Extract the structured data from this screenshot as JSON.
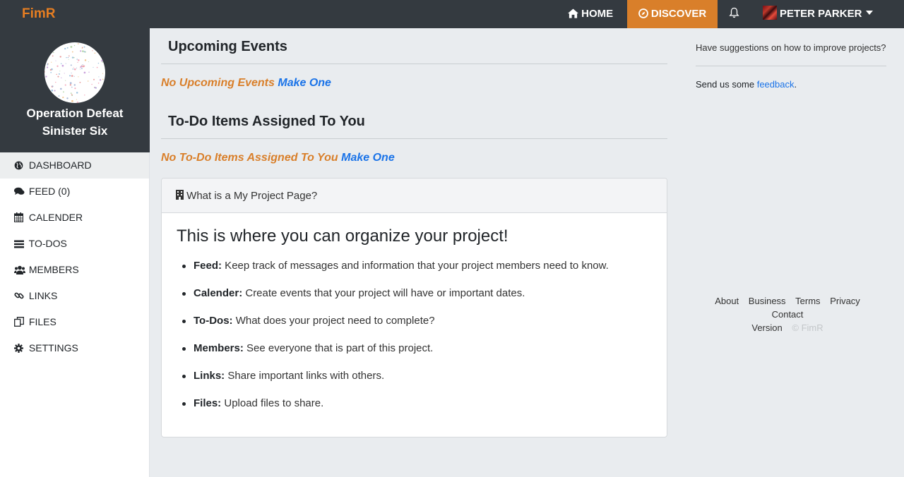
{
  "navbar": {
    "brand": "FimR",
    "home_label": "HOME",
    "discover_label": "DISCOVER",
    "user_name": "PETER PARKER"
  },
  "project": {
    "name_line1": "Operation Defeat",
    "name_line2": "Sinister Six"
  },
  "sidebar": {
    "items": [
      {
        "label": "DASHBOARD",
        "icon": "globe-icon",
        "active": true
      },
      {
        "label": "FEED (0)",
        "icon": "comments-icon"
      },
      {
        "label": "CALENDER",
        "icon": "calendar-icon"
      },
      {
        "label": "TO-DOS",
        "icon": "list-icon"
      },
      {
        "label": "MEMBERS",
        "icon": "users-icon"
      },
      {
        "label": "LINKS",
        "icon": "link-icon"
      },
      {
        "label": "FILES",
        "icon": "files-icon"
      },
      {
        "label": "SETTINGS",
        "icon": "gear-icon"
      }
    ]
  },
  "main": {
    "events_title": "Upcoming Events",
    "events_empty": "No Upcoming Events",
    "events_make": "Make One",
    "todos_title": "To-Do Items Assigned To You",
    "todos_empty": "No To-Do Items Assigned To You",
    "todos_make": "Make One",
    "card": {
      "header": "What is a My Project Page?",
      "title": "This is where you can organize your project!",
      "features": [
        {
          "name": "Feed:",
          "desc": " Keep track of messages and information that your project members need to know."
        },
        {
          "name": "Calender:",
          "desc": " Create events that your project will have or important dates."
        },
        {
          "name": "To-Dos:",
          "desc": " What does your project need to complete?"
        },
        {
          "name": "Members:",
          "desc": " See everyone that is part of this project."
        },
        {
          "name": "Links:",
          "desc": " Share important links with others."
        },
        {
          "name": "Files:",
          "desc": " Upload files to share."
        }
      ]
    }
  },
  "right": {
    "suggest": "Have suggestions on how to improve projects?",
    "send_prefix": "Send us some ",
    "feedback_link": "feedback",
    "send_suffix": ".",
    "footer": {
      "about": "About",
      "business": "Business",
      "terms": "Terms",
      "privacy": "Privacy",
      "contact": "Contact",
      "version": "Version",
      "copyright": "© FimR"
    }
  },
  "colors": {
    "accent": "#d97f2a",
    "link": "#1a73e8",
    "dark": "#343a40"
  }
}
